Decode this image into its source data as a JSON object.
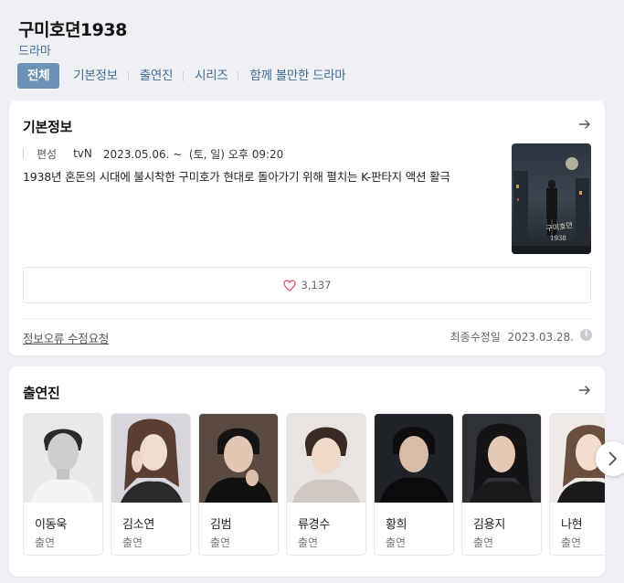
{
  "header": {
    "title": "구미호뎐1938",
    "genre": "드라마",
    "tabs": [
      "전체",
      "기본정보",
      "출연진",
      "시리즈",
      "함께 볼만한 드라마"
    ]
  },
  "basic_info": {
    "title": "기본정보",
    "label": "편성",
    "network": "tvN",
    "schedule": "2023.05.06. ~  (토, 일) 오후 09:20",
    "description": "1938년 혼돈의 시대에 불시착한 구미호가 현대로 돌아가기 위해 펼치는 K-판타지 액션 활극",
    "likes": "3,137",
    "report_link": "정보오류 수정요청",
    "updated": "최종수정일  2023.03.28.",
    "info_icon": "i"
  },
  "cast": {
    "title": "출연진",
    "members": [
      {
        "name": "이동욱",
        "role": "출연"
      },
      {
        "name": "김소연",
        "role": "출연"
      },
      {
        "name": "김범",
        "role": "출연"
      },
      {
        "name": "류경수",
        "role": "출연"
      },
      {
        "name": "황희",
        "role": "출연"
      },
      {
        "name": "김용지",
        "role": "출연"
      },
      {
        "name": "나현",
        "role": "출연"
      }
    ]
  },
  "colors": {
    "accent": "#6b92b5",
    "link": "#3e6a96",
    "heart": "#e84a5f"
  }
}
